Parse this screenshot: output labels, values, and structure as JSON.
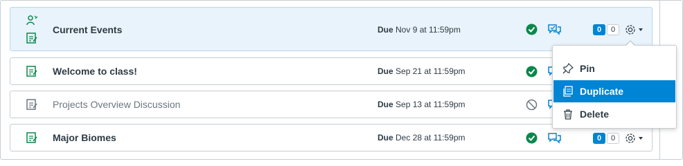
{
  "rows": [
    {
      "title": "Current Events",
      "due_label": "Due",
      "due_date": "Nov 9 at 11:59pm",
      "status": "published",
      "unread": "0",
      "total": "0"
    },
    {
      "title": "Welcome to class!",
      "due_label": "Due",
      "due_date": "Sep 21 at 11:59pm",
      "status": "published"
    },
    {
      "title": "Projects Overview Discussion",
      "due_label": "Due",
      "due_date": "Sep 13 at 11:59pm",
      "status": "unpublished"
    },
    {
      "title": "Major Biomes",
      "due_label": "Due",
      "due_date": "Dec 28 at 11:59pm",
      "status": "published",
      "unread": "0",
      "total": "0"
    }
  ],
  "menu": {
    "items": [
      {
        "label": "Pin",
        "icon": "pin-icon"
      },
      {
        "label": "Duplicate",
        "icon": "duplicate-icon",
        "active": true
      },
      {
        "label": "Delete",
        "icon": "trash-icon"
      }
    ]
  },
  "colors": {
    "accent": "#0084d4",
    "success": "#0b874b",
    "highlight": "#e8f3fb",
    "muted": "#6b7780"
  }
}
